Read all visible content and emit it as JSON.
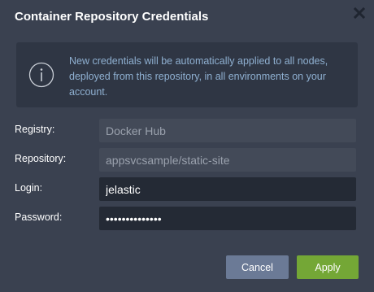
{
  "dialog": {
    "title": "Container Repository Credentials",
    "close_icon": "close-icon",
    "info": {
      "icon": "info-icon",
      "text": "New credentials will be automatically applied to all nodes, deployed from this repository, in all environments on your account."
    },
    "fields": {
      "registry": {
        "label": "Registry:",
        "value": "Docker Hub"
      },
      "repository": {
        "label": "Repository:",
        "value": "appsvcsample/static-site"
      },
      "login": {
        "label": "Login:",
        "value": "jelastic"
      },
      "password": {
        "label": "Password:",
        "value": "••••••••••••••"
      }
    },
    "buttons": {
      "cancel": "Cancel",
      "apply": "Apply"
    }
  },
  "colors": {
    "background": "#3a4150",
    "info_panel": "#2f3644",
    "info_text": "#8fb0d1",
    "cancel_button": "#6b7a96",
    "apply_button": "#74a736"
  }
}
